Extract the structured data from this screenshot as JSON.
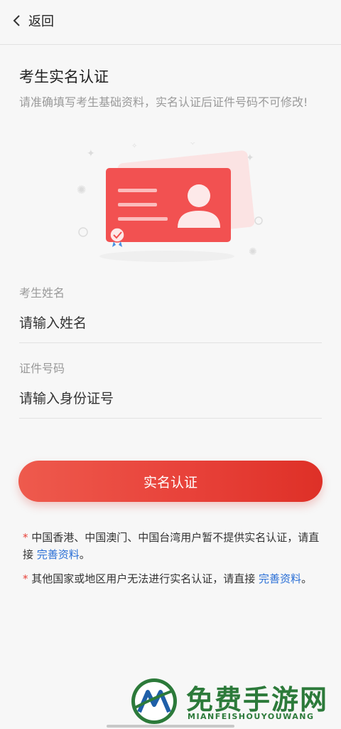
{
  "nav": {
    "back_label": "返回"
  },
  "page": {
    "title": "考生实名认证",
    "subtitle": "请准确填写考生基础资料，实名认证后证件号码不可修改!"
  },
  "form": {
    "name_label": "考生姓名",
    "name_placeholder": "请输入姓名",
    "id_label": "证件号码",
    "id_placeholder": "请输入身份证号"
  },
  "submit_label": "实名认证",
  "notes": [
    {
      "star": "*",
      "text": " 中国香港、中国澳门、中国台湾用户暂不提供实名认证，请直接 ",
      "link": "完善资料",
      "suffix": "。"
    },
    {
      "star": "*",
      "text": " 其他国家或地区用户无法进行实名认证，请直接 ",
      "link": "完善资料",
      "suffix": "。"
    }
  ],
  "watermark": {
    "cn": "免费手游网",
    "en": "MIANFEISHOUYOUWANG"
  },
  "colors": {
    "accent": "#e8423a",
    "link": "#2a6fd6",
    "watermark": "#2c7a3a"
  },
  "icons": [
    "chevron-left-icon",
    "id-card-illustration",
    "badge-icon"
  ]
}
